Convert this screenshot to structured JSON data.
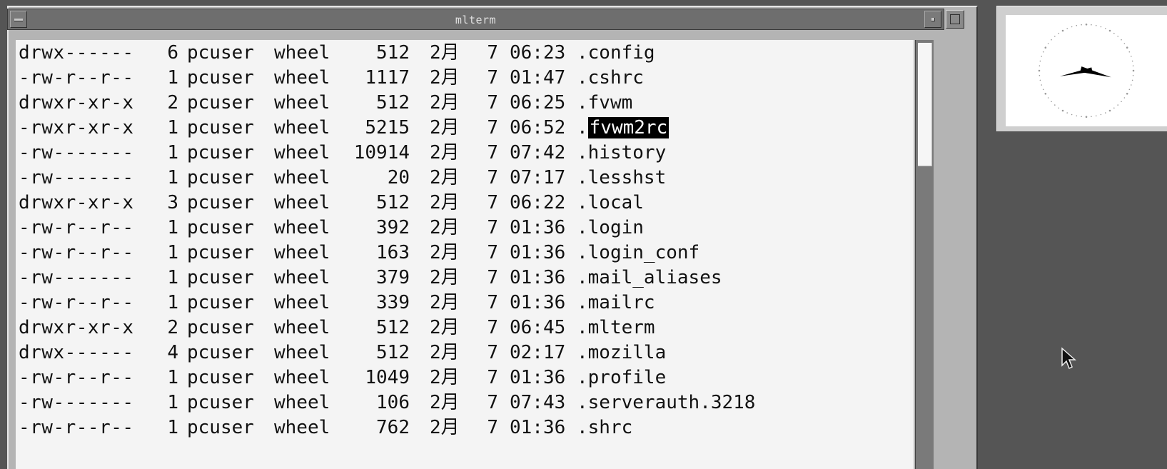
{
  "window": {
    "title": "mlterm"
  },
  "terminal": {
    "rows": [
      {
        "perm": "drwx------",
        "links": "6",
        "owner": "pcuser",
        "group": "wheel",
        "size": "512",
        "month": "2月",
        "day": "7",
        "time": "06:23",
        "name_prefix": ".",
        "name": "config",
        "highlight": false
      },
      {
        "perm": "-rw-r--r--",
        "links": "1",
        "owner": "pcuser",
        "group": "wheel",
        "size": "1117",
        "month": "2月",
        "day": "7",
        "time": "01:47",
        "name_prefix": ".",
        "name": "cshrc",
        "highlight": false
      },
      {
        "perm": "drwxr-xr-x",
        "links": "2",
        "owner": "pcuser",
        "group": "wheel",
        "size": "512",
        "month": "2月",
        "day": "7",
        "time": "06:25",
        "name_prefix": ".",
        "name": "fvwm",
        "highlight": false
      },
      {
        "perm": "-rwxr-xr-x",
        "links": "1",
        "owner": "pcuser",
        "group": "wheel",
        "size": "5215",
        "month": "2月",
        "day": "7",
        "time": "06:52",
        "name_prefix": ".",
        "name": "fvwm2rc",
        "highlight": true
      },
      {
        "perm": "-rw-------",
        "links": "1",
        "owner": "pcuser",
        "group": "wheel",
        "size": "10914",
        "month": "2月",
        "day": "7",
        "time": "07:42",
        "name_prefix": ".",
        "name": "history",
        "highlight": false
      },
      {
        "perm": "-rw-------",
        "links": "1",
        "owner": "pcuser",
        "group": "wheel",
        "size": "20",
        "month": "2月",
        "day": "7",
        "time": "07:17",
        "name_prefix": ".",
        "name": "lesshst",
        "highlight": false
      },
      {
        "perm": "drwxr-xr-x",
        "links": "3",
        "owner": "pcuser",
        "group": "wheel",
        "size": "512",
        "month": "2月",
        "day": "7",
        "time": "06:22",
        "name_prefix": ".",
        "name": "local",
        "highlight": false
      },
      {
        "perm": "-rw-r--r--",
        "links": "1",
        "owner": "pcuser",
        "group": "wheel",
        "size": "392",
        "month": "2月",
        "day": "7",
        "time": "01:36",
        "name_prefix": ".",
        "name": "login",
        "highlight": false
      },
      {
        "perm": "-rw-r--r--",
        "links": "1",
        "owner": "pcuser",
        "group": "wheel",
        "size": "163",
        "month": "2月",
        "day": "7",
        "time": "01:36",
        "name_prefix": ".",
        "name": "login_conf",
        "highlight": false
      },
      {
        "perm": "-rw-------",
        "links": "1",
        "owner": "pcuser",
        "group": "wheel",
        "size": "379",
        "month": "2月",
        "day": "7",
        "time": "01:36",
        "name_prefix": ".",
        "name": "mail_aliases",
        "highlight": false
      },
      {
        "perm": "-rw-r--r--",
        "links": "1",
        "owner": "pcuser",
        "group": "wheel",
        "size": "339",
        "month": "2月",
        "day": "7",
        "time": "01:36",
        "name_prefix": ".",
        "name": "mailrc",
        "highlight": false
      },
      {
        "perm": "drwxr-xr-x",
        "links": "2",
        "owner": "pcuser",
        "group": "wheel",
        "size": "512",
        "month": "2月",
        "day": "7",
        "time": "06:45",
        "name_prefix": ".",
        "name": "mlterm",
        "highlight": false
      },
      {
        "perm": "drwx------",
        "links": "4",
        "owner": "pcuser",
        "group": "wheel",
        "size": "512",
        "month": "2月",
        "day": "7",
        "time": "02:17",
        "name_prefix": ".",
        "name": "mozilla",
        "highlight": false
      },
      {
        "perm": "-rw-r--r--",
        "links": "1",
        "owner": "pcuser",
        "group": "wheel",
        "size": "1049",
        "month": "2月",
        "day": "7",
        "time": "01:36",
        "name_prefix": ".",
        "name": "profile",
        "highlight": false
      },
      {
        "perm": "-rw-------",
        "links": "1",
        "owner": "pcuser",
        "group": "wheel",
        "size": "106",
        "month": "2月",
        "day": "7",
        "time": "07:43",
        "name_prefix": ".",
        "name": "serverauth.3218",
        "highlight": false
      },
      {
        "perm": "-rw-r--r--",
        "links": "1",
        "owner": "pcuser",
        "group": "wheel",
        "size": "762",
        "month": "2月",
        "day": "7",
        "time": "01:36",
        "name_prefix": ".",
        "name": "shrc",
        "highlight": false
      }
    ]
  },
  "scrollbar": {
    "position_fraction": 0.0,
    "visible_fraction": 0.29
  },
  "clock": {
    "hour_hand_angle_deg": 105,
    "minute_hand_angle_deg": 118
  },
  "icons": {
    "window_menu": "window-menu-icon",
    "iconify": "iconify-icon",
    "maximize": "maximize-icon",
    "clock": "analog-clock-icon",
    "cursor": "mouse-pointer-icon"
  },
  "colors": {
    "desktop": "#555555",
    "titlebar": "#6e6e6e",
    "terminal_bg": "#f4f4f4",
    "terminal_fg": "#111111",
    "selection_bg": "#000000",
    "selection_fg": "#ffffff"
  }
}
